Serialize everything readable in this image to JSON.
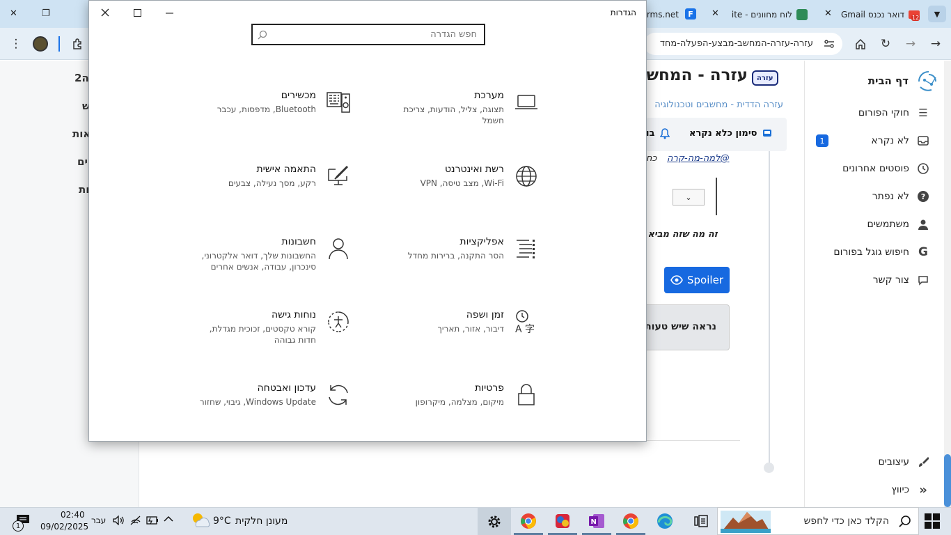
{
  "browser": {
    "tabs": [
      {
        "label": "דואר נכנס Gmail",
        "badge": "12"
      },
      {
        "label": "לוח מחוונים - ite"
      },
      {
        "label": "rms.net/"
      }
    ],
    "url": "עזרה-עזרה-המחשב-מבצע-הפעלה-מחד"
  },
  "forum": {
    "sidebar": {
      "home": "דף הבית",
      "items": [
        {
          "label": "חוקי הפורום",
          "icon": "menu-lines-icon"
        },
        {
          "label": "לא נקרא",
          "icon": "inbox-icon",
          "badge": "1"
        },
        {
          "label": "פוסטים אחרונים",
          "icon": "clock-icon"
        },
        {
          "label": "לא נפתר",
          "icon": "question-icon"
        },
        {
          "label": "משתמשים",
          "icon": "user-icon"
        },
        {
          "label": "חיפוש גוגל בפורום",
          "icon": "google-icon"
        },
        {
          "label": "צור קשר",
          "icon": "chat-icon"
        }
      ],
      "bottom": [
        {
          "label": "עיצובים",
          "icon": "brush-icon"
        },
        {
          "label": "כיווץ",
          "icon": "double-chevron-icon"
        }
      ]
    },
    "content": {
      "tag": "עזרה",
      "title_fragment": "עזרה - המחש",
      "breadcrumb": "עזרה הדדית - מחשבים וטכנולוגיה",
      "mark_read": "סימון כלא נקרא",
      "mark_read_cut": "בו",
      "mention": "@למה-מה-קרה",
      "mention_cut": "כח",
      "quote_cut": "זה מה שזה מביא לי",
      "spoiler_label": "Spoiler",
      "post_cut": "נראה שיש טעות"
    },
    "left_panel": {
      "fragments": [
        "לה2",
        "ש",
        "אות",
        "ים",
        "ות"
      ]
    }
  },
  "settings": {
    "window_title": "הגדרות",
    "search_placeholder": "חפש הגדרה",
    "tiles": [
      {
        "title": "מערכת",
        "desc": "תצוגה, צליל, הודעות, צריכת חשמל",
        "icon": "laptop-icon"
      },
      {
        "title": "מכשירים",
        "desc": "Bluetooth, מדפסות, עכבר",
        "icon": "keyboard-speaker-icon"
      },
      {
        "title": "רשת ואינטרנט",
        "desc": "Wi-Fi, מצב טיסה, VPN",
        "icon": "globe-icon"
      },
      {
        "title": "התאמה אישית",
        "desc": "רקע, מסך נעילה, צבעים",
        "icon": "paint-screen-icon"
      },
      {
        "title": "אפליקציות",
        "desc": "הסר התקנה, ברירות מחדל",
        "icon": "app-list-icon"
      },
      {
        "title": "חשבונות",
        "desc": "החשבונות שלך, דואר אלקטרוני, סינכרון, עבודה, אנשים אחרים",
        "icon": "person-icon"
      },
      {
        "title": "זמן ושפה",
        "desc": "דיבור, אזור, תאריך",
        "icon": "time-language-icon"
      },
      {
        "title": "נוחות גישה",
        "desc": "קורא טקסטים, זכוכית מגדלת, חדות גבוהה",
        "icon": "ease-of-access-icon"
      },
      {
        "title": "פרטיות",
        "desc": "מיקום, מצלמה, מיקרופון",
        "icon": "lock-icon"
      },
      {
        "title": "עדכון ואבטחה",
        "desc": "Windows Update, גיבוי, שחזור",
        "icon": "refresh-icon"
      }
    ]
  },
  "taskbar": {
    "search_placeholder": "הקלד כאן כדי לחפש",
    "weather": {
      "temp": "9°C",
      "condition": "מעונן חלקית"
    },
    "language": "עבר",
    "time": "02:40",
    "date": "09/02/2025",
    "notification_count": "1"
  }
}
